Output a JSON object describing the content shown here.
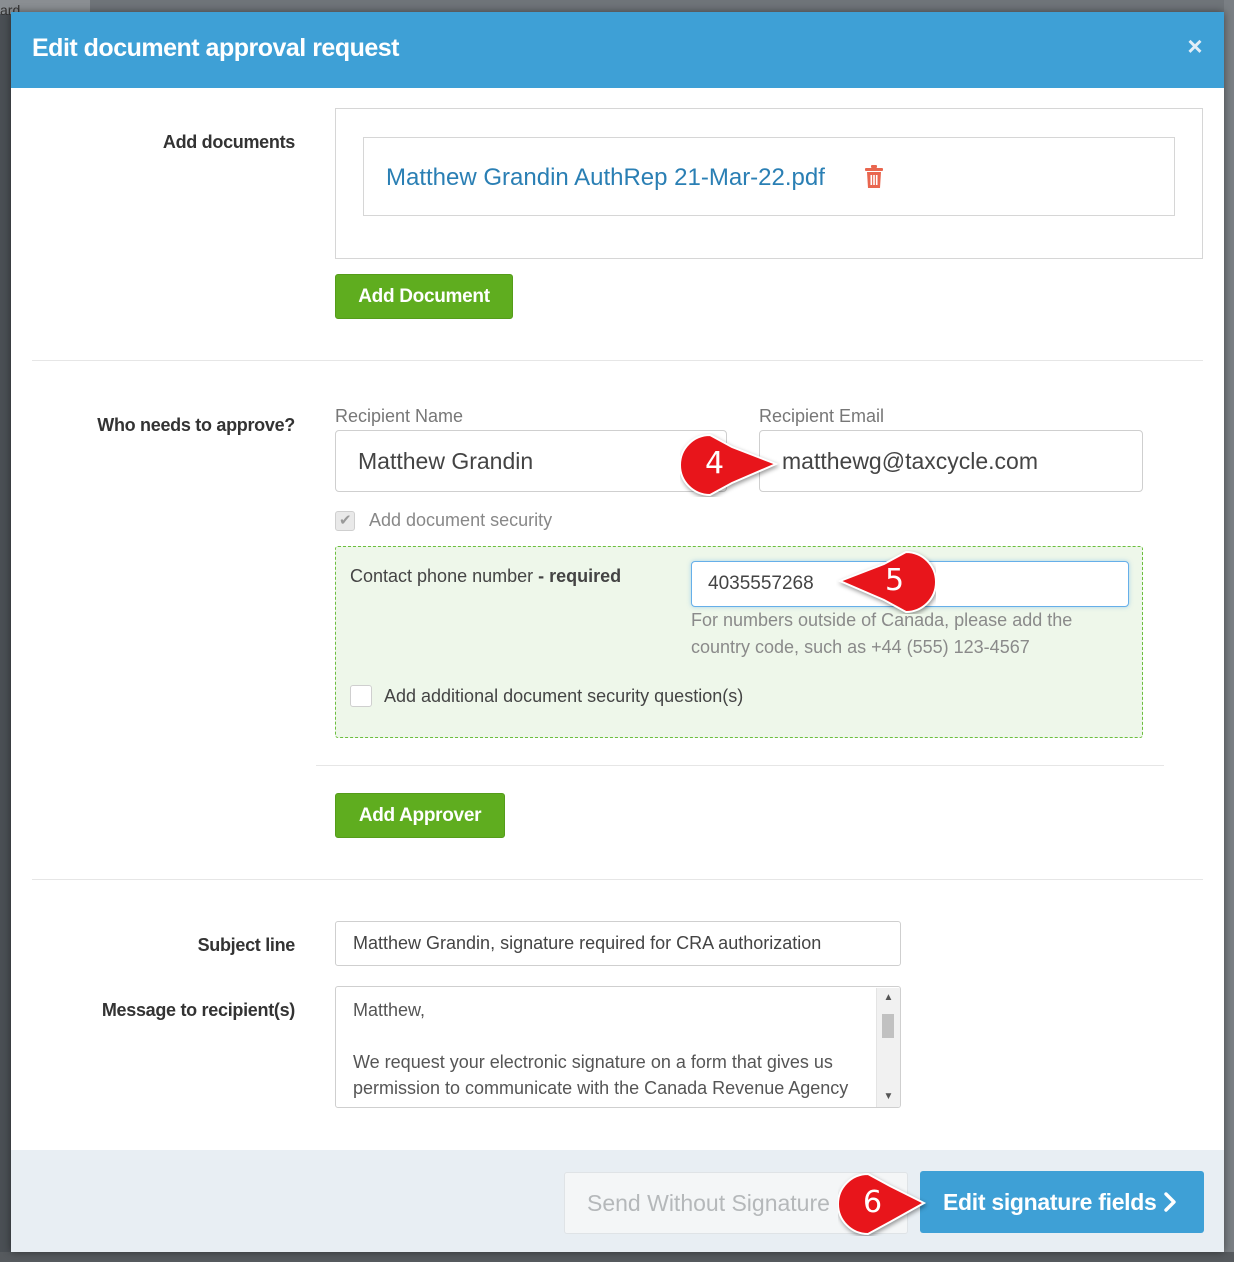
{
  "background": {
    "edge_text": "ard"
  },
  "modal": {
    "title": "Edit document approval request",
    "close_symbol": "×",
    "header_color": "#3ea0d6"
  },
  "documents": {
    "label": "Add documents",
    "files": [
      {
        "name": "Matthew Grandin AuthRep 21-Mar-22.pdf",
        "icon": "trash-icon"
      }
    ],
    "add_button": "Add Document",
    "add_icon": "plus-icon"
  },
  "approvers": {
    "label": "Who needs to approve?",
    "name_label": "Recipient Name",
    "name_value": "Matthew Grandin",
    "email_label": "Recipient Email",
    "email_value": "matthewg@taxcycle.com",
    "security_checkbox_label": "Add document security",
    "security_checked": true,
    "phone_label": "Contact phone number",
    "phone_required": " - required",
    "phone_value": "4035557268",
    "phone_help": "For numbers outside of Canada, please add the country code, such as +44 (555) 123-4567",
    "question_checkbox_label": "Add additional document security question(s)",
    "question_checked": false,
    "add_button": "Add Approver",
    "green_color": "#5fad1f"
  },
  "subject": {
    "label": "Subject line",
    "value": "Matthew Grandin, signature required for CRA authorization"
  },
  "message": {
    "label": "Message to recipient(s)",
    "value": "Matthew,\n\nWe request your electronic signature on a form that gives us permission to communicate with the Canada Revenue Agency"
  },
  "footer": {
    "secondary_button": "Send Without Signature",
    "primary_button": "Edit signature fields"
  },
  "callouts": [
    {
      "number": "4",
      "color": "#e8151b"
    },
    {
      "number": "5",
      "color": "#e8151b"
    },
    {
      "number": "6",
      "color": "#e8151b"
    }
  ]
}
